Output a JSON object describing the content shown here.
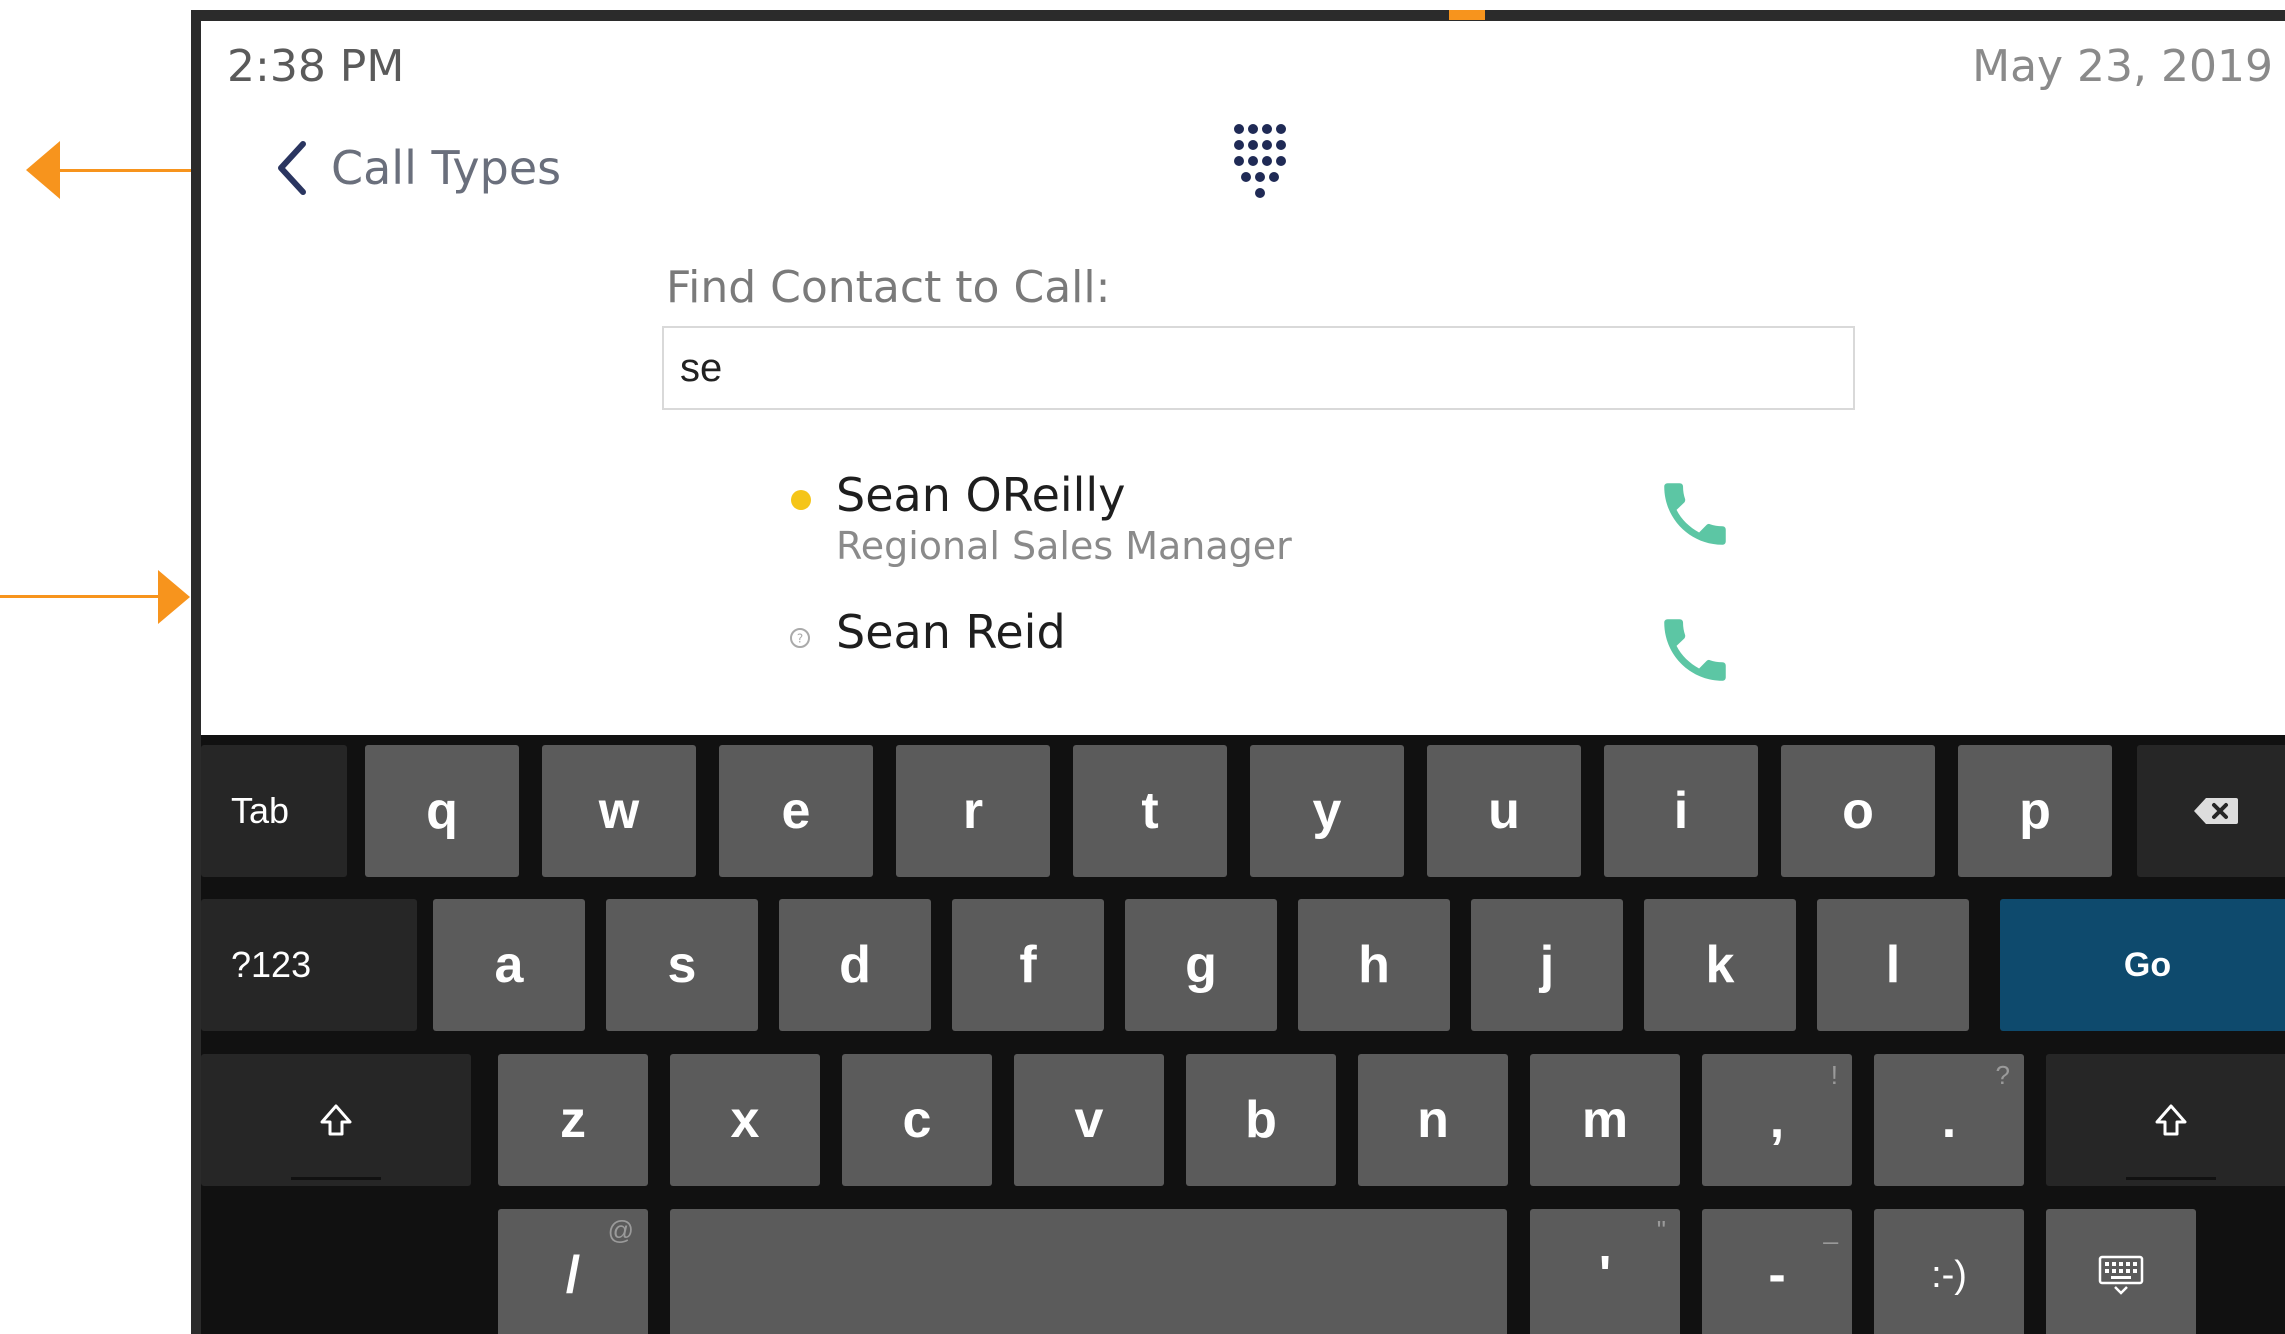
{
  "status_bar": {
    "time": "2:38 PM",
    "date": "May 23, 2019"
  },
  "header": {
    "back_label": "Call Types"
  },
  "search": {
    "label": "Find Contact to Call:",
    "value": "se"
  },
  "contacts": [
    {
      "name": "Sean OReilly",
      "title": "Regional Sales Manager",
      "presence": "away",
      "presence_color": "#f5c518"
    },
    {
      "name": "Sean Reid",
      "title": "",
      "presence": "unknown"
    }
  ],
  "colors": {
    "accent_orange": "#f7941d",
    "call_green": "#5cc6a4",
    "go_blue": "#0e4a6d"
  },
  "keyboard": {
    "row1": [
      "Tab",
      "q",
      "w",
      "e",
      "r",
      "t",
      "y",
      "u",
      "i",
      "o",
      "p",
      "backspace-icon"
    ],
    "row2": [
      "?123",
      "a",
      "s",
      "d",
      "f",
      "g",
      "h",
      "j",
      "k",
      "l",
      "Go"
    ],
    "row3": [
      "shift-icon",
      "z",
      "x",
      "c",
      "v",
      "b",
      "n",
      "m",
      ",",
      ".",
      "shift-icon"
    ],
    "row3_alts": {
      ",": "!",
      ".": "?"
    },
    "row4": [
      "/",
      "",
      "'",
      "-",
      ":-)",
      "keyboard-hide-icon"
    ],
    "row4_alts": {
      "/": "@",
      "'": "\"",
      "-": "_"
    }
  }
}
